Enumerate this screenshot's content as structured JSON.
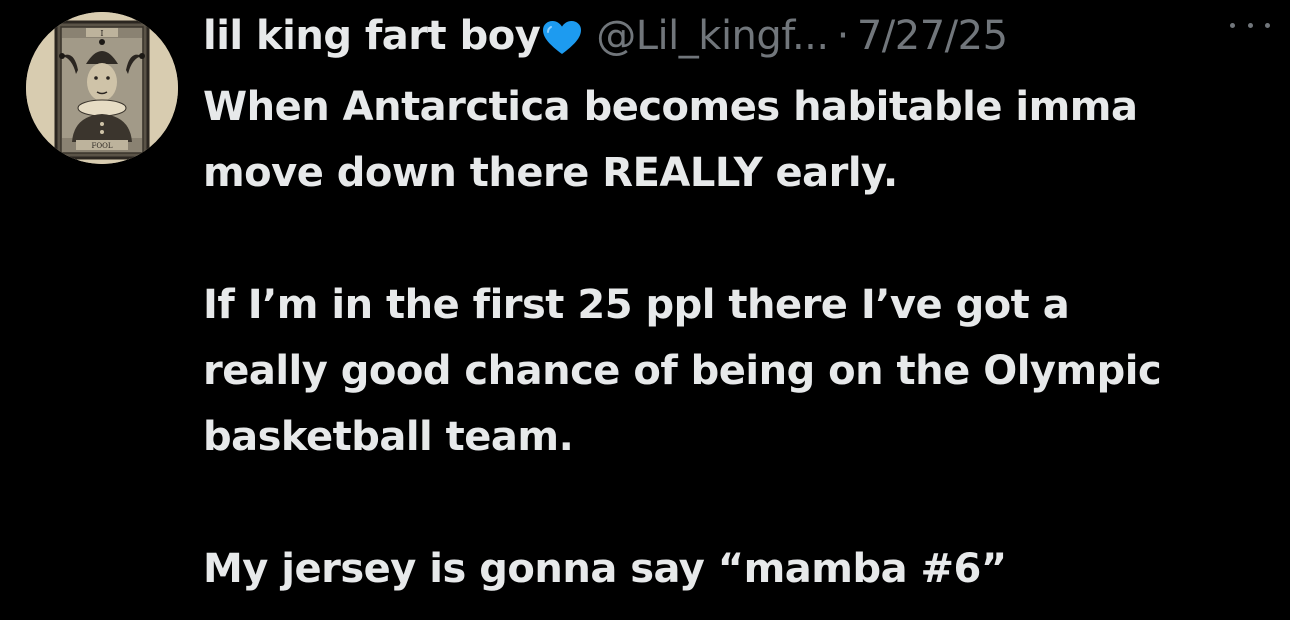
{
  "tweet": {
    "author": {
      "display_name": "lil king fart boy",
      "name_emoji": "blue-heart-emoji",
      "handle": "@Lil_kingf...",
      "avatar_label": "FOOL",
      "avatar_numeral": "I"
    },
    "separator": "·",
    "timestamp": "7/27/25",
    "more_icon": "more-horizontal-icon",
    "text_lines": [
      "When Antarctica becomes habitable imma",
      "move down there REALLY early.",
      "",
      "If I’m in the first 25 ppl there I’ve got a",
      "really good chance of being on the Olympic",
      "basketball team.",
      "",
      "My jersey is gonna say “mamba #6”"
    ]
  },
  "colors": {
    "background": "#000000",
    "primary_text": "#e7e9ea",
    "secondary_text": "#71767b",
    "heart": "#1d9bf0"
  }
}
